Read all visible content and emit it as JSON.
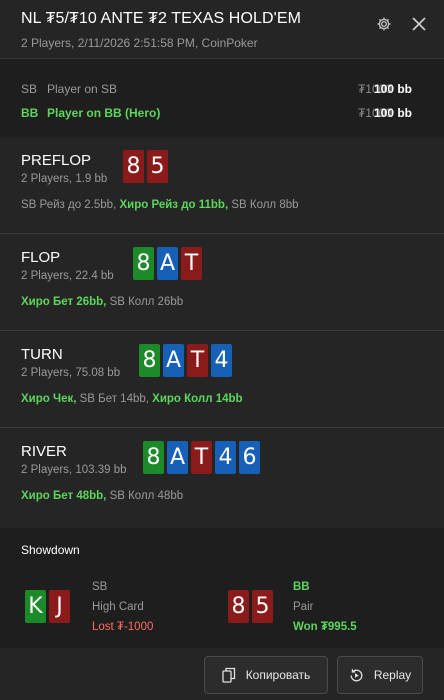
{
  "header": {
    "title": "NL ₮5/₮10 ANTE ₮2 TEXAS HOLD'EM",
    "subtitle": "2 Players, 2/11/2026 2:51:58 PM, CoinPoker"
  },
  "players": [
    {
      "pos": "SB",
      "name": "Player on SB",
      "stack": "₮1000",
      "bb": "100 bb"
    },
    {
      "pos": "BB",
      "name": "Player on BB (Hero)",
      "stack": "₮1000",
      "bb": "100 bb"
    }
  ],
  "streets": [
    {
      "name": "PREFLOP",
      "info": "2 Players, 1.9 bb",
      "cards": [
        {
          "rank": "8",
          "color": "red"
        },
        {
          "rank": "5",
          "color": "red"
        }
      ],
      "actions": [
        {
          "text": "SB Рейз до 2.5bb,",
          "hero": false
        },
        {
          "text": "Хиро Рейз до 11bb,",
          "hero": true
        },
        {
          "text": "SB Колл 8bb",
          "hero": false
        }
      ]
    },
    {
      "name": "FLOP",
      "info": "2 Players, 22.4 bb",
      "cards": [
        {
          "rank": "8",
          "color": "green"
        },
        {
          "rank": "A",
          "color": "blue"
        },
        {
          "rank": "T",
          "color": "red"
        }
      ],
      "actions": [
        {
          "text": "Хиро Бет 26bb,",
          "hero": true
        },
        {
          "text": "SB Колл 26bb",
          "hero": false
        }
      ]
    },
    {
      "name": "TURN",
      "info": "2 Players, 75.08 bb",
      "cards": [
        {
          "rank": "8",
          "color": "green"
        },
        {
          "rank": "A",
          "color": "blue"
        },
        {
          "rank": "T",
          "color": "red"
        },
        {
          "rank": "4",
          "color": "blue"
        }
      ],
      "actions": [
        {
          "text": "Хиро Чек,",
          "hero": true
        },
        {
          "text": "SB Бет 14bb,",
          "hero": false
        },
        {
          "text": "Хиро Колл 14bb",
          "hero": true
        }
      ]
    },
    {
      "name": "RIVER",
      "info": "2 Players, 103.39 bb",
      "cards": [
        {
          "rank": "8",
          "color": "green"
        },
        {
          "rank": "A",
          "color": "blue"
        },
        {
          "rank": "T",
          "color": "red"
        },
        {
          "rank": "4",
          "color": "blue"
        },
        {
          "rank": "6",
          "color": "blue"
        }
      ],
      "actions": [
        {
          "text": "Хиро Бет 48bb,",
          "hero": true
        },
        {
          "text": "SB Колл 48bb",
          "hero": false
        }
      ]
    }
  ],
  "showdown": {
    "title": "Showdown",
    "players": [
      {
        "pos": "SB",
        "hand": "High Card",
        "result": "Lost ₮-1000",
        "won": false,
        "cards": [
          {
            "rank": "K",
            "color": "green"
          },
          {
            "rank": "J",
            "color": "red"
          }
        ]
      },
      {
        "pos": "BB",
        "hand": "Pair",
        "result": "Won ₮995.5",
        "won": true,
        "cards": [
          {
            "rank": "8",
            "color": "red"
          },
          {
            "rank": "5",
            "color": "red"
          }
        ]
      }
    ]
  },
  "footer": {
    "copy_label": "Копировать",
    "replay_label": "Replay"
  },
  "icons": {
    "gear": "gear-icon",
    "close": "close-icon",
    "copy": "copy-icon",
    "replay": "replay-icon"
  },
  "colors": {
    "hero_green": "#5cd65c",
    "card_red": "#8b1a1a",
    "card_green": "#1d8a2a",
    "card_blue": "#1760b8",
    "lost_red": "#ff6b5e",
    "won_green": "#5cd65c"
  }
}
